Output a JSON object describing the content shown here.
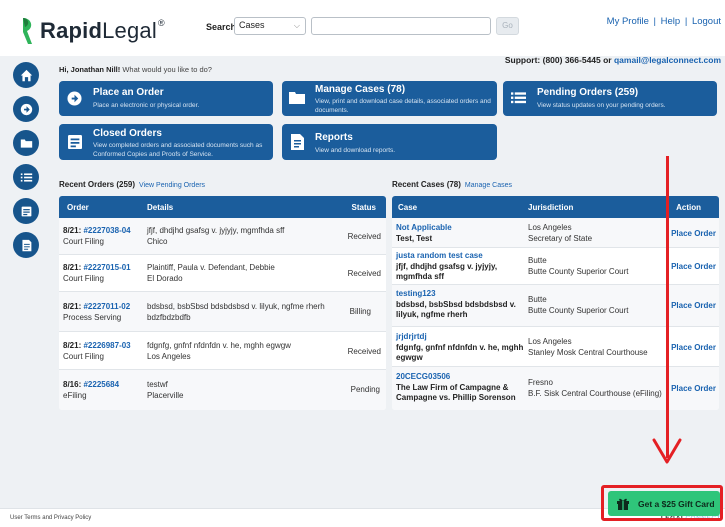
{
  "brand": {
    "name_bold": "Rapid",
    "name_light": "Legal",
    "reg": "®"
  },
  "search": {
    "label": "Search:",
    "scope": "Cases",
    "placeholder": "",
    "go": "Go"
  },
  "top_links": [
    "My Profile",
    "Help",
    "Logout"
  ],
  "support": {
    "prefix": "Support: (800) 366-5445 or ",
    "email": "qamail@legalconnect.com"
  },
  "greeting": {
    "name": "Hi, Jonathan Nill!",
    "prompt": " What would you like to do?"
  },
  "tiles": {
    "place_order": {
      "title": "Place an Order",
      "desc": "Place an electronic or physical order."
    },
    "manage_cases": {
      "title": "Manage Cases (78)",
      "desc": "View, print and download case details, associated orders and documents."
    },
    "pending_orders": {
      "title": "Pending Orders (259)",
      "desc": "View status updates on your pending orders."
    },
    "closed_orders": {
      "title": "Closed Orders",
      "desc": "View completed orders and associated documents such as Conformed Copies and Proofs of Service."
    },
    "reports": {
      "title": "Reports",
      "desc": "View and download reports."
    }
  },
  "recent_orders": {
    "title": "Recent Orders (259)",
    "link": "View Pending Orders",
    "headers": {
      "order": "Order",
      "details": "Details",
      "status": "Status"
    },
    "rows": [
      {
        "date": "8/21:",
        "num": "#2227038-04",
        "type": "Court Filing",
        "d1": "jfjf, dhdjhd gsafsg v. jyjyjy, mgmfhda sff",
        "d2": "Chico",
        "status": "Received"
      },
      {
        "date": "8/21:",
        "num": "#2227015-01",
        "type": "Court Filing",
        "d1": "Plaintiff, Paula v. Defendant, Debbie",
        "d2": "El Dorado",
        "status": "Received"
      },
      {
        "date": "8/21:",
        "num": "#2227011-02",
        "type": "Process Serving",
        "d1": "bdsbsd, bsbSbsd bdsbdsbsd v. lilyuk, ngfme rherh",
        "d2": "bdzfbdzbdfb",
        "status": "Billing"
      },
      {
        "date": "8/21:",
        "num": "#2226987-03",
        "type": "Court Filing",
        "d1": "fdgnfg, gnfnf nfdnfdn v. he, mghh egwgw",
        "d2": "Los Angeles",
        "status": "Received"
      },
      {
        "date": "8/16:",
        "num": "#2225684",
        "type": "eFiling",
        "d1": "testwf",
        "d2": "Placerville",
        "status": "Pending"
      }
    ]
  },
  "recent_cases": {
    "title": "Recent Cases (78)",
    "link": "Manage Cases",
    "headers": {
      "case": "Case",
      "jurisdiction": "Jurisdiction",
      "action": "Action"
    },
    "rows": [
      {
        "num": "Not Applicable",
        "name": "Test, Test",
        "j1": "Los Angeles",
        "j2": "Secretary of State",
        "action": "Place Order"
      },
      {
        "num": "justa random test case",
        "name": "jfjf, dhdjhd gsafsg v. jyjyjy, mgmfhda sff",
        "j1": "Butte",
        "j2": "Butte County Superior Court",
        "action": "Place Order"
      },
      {
        "num": "testing123",
        "name": "bdsbsd, bsbSbsd bdsbdsbsd v. lilyuk, ngfme rherh",
        "j1": "Butte",
        "j2": "Butte County Superior Court",
        "action": "Place Order"
      },
      {
        "num": "jrjdrjrtdj",
        "name": "fdgnfg, gnfnf nfdnfdn v. he, mghh egwgw",
        "j1": "Los Angeles",
        "j2": "Stanley Mosk Central Courthouse",
        "action": "Place Order"
      },
      {
        "num": "20CECG03506",
        "name": "The Law Firm of Campagne & Campagne vs. Phillip Sorenson",
        "j1": "Fresno",
        "j2": "B.F. Sisk Central Courthouse (eFiling)",
        "action": "Place Order"
      }
    ]
  },
  "footer": {
    "links": "User Terms and Privacy Policy",
    "brand_dark": "LEGAL",
    "brand_light": "CONNECT"
  },
  "gift": {
    "label": "Get a $25 Gift Card"
  },
  "colors": {
    "primary": "#1b5d9c",
    "link": "#1a63b0",
    "annotation": "#e42024",
    "gift": "#2fc57a"
  },
  "icons": [
    "home-icon",
    "arrow-right-circle-icon",
    "folder-icon",
    "list-icon",
    "form-icon",
    "document-icon",
    "gift-icon"
  ]
}
